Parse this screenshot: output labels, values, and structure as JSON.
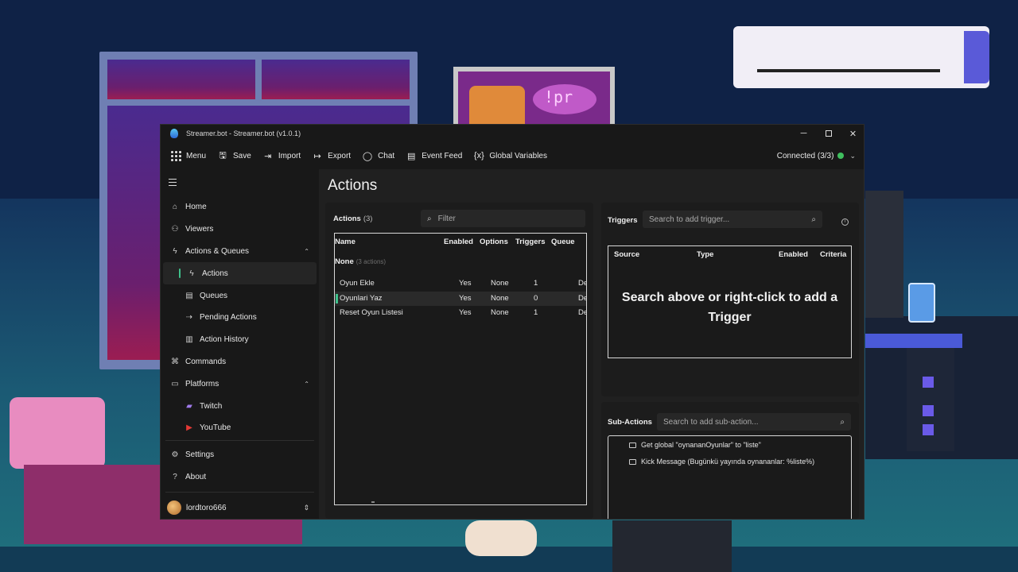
{
  "window": {
    "title": "Streamer.bot - Streamer.bot (v1.0.1)",
    "minimize": "─",
    "close": "✕"
  },
  "toolbar": {
    "menu": "Menu",
    "save": "Save",
    "import": "Import",
    "export": "Export",
    "chat": "Chat",
    "event_feed": "Event Feed",
    "global_variables": "Global Variables",
    "connection": "Connected (3/3)",
    "connection_color": "#3fbf5e"
  },
  "sidebar": {
    "items": [
      {
        "label": "Home",
        "icon": "home-icon"
      },
      {
        "label": "Viewers",
        "icon": "users-icon"
      },
      {
        "label": "Actions & Queues",
        "icon": "bolt-icon"
      },
      {
        "label": "Actions",
        "icon": "bolt-icon"
      },
      {
        "label": "Queues",
        "icon": "queue-icon"
      },
      {
        "label": "Pending Actions",
        "icon": "pending-icon"
      },
      {
        "label": "Action History",
        "icon": "history-icon"
      },
      {
        "label": "Commands",
        "icon": "command-icon"
      },
      {
        "label": "Platforms",
        "icon": "platforms-icon"
      },
      {
        "label": "Twitch",
        "icon": "twitch-icon"
      },
      {
        "label": "YouTube",
        "icon": "youtube-icon"
      }
    ],
    "bottom": [
      {
        "label": "Settings",
        "icon": "gear-icon"
      },
      {
        "label": "About",
        "icon": "help-icon"
      }
    ],
    "user": "lordtoro666"
  },
  "page": {
    "title": "Actions"
  },
  "actions": {
    "header": "Actions",
    "count": "(3)",
    "filter_placeholder": "Filter",
    "columns": [
      "Name",
      "Enabled",
      "Options",
      "Triggers",
      "Queue"
    ],
    "group": {
      "name": "None",
      "count": "(3 actions)"
    },
    "rows": [
      {
        "name": "Oyun Ekle",
        "enabled": "Yes",
        "options": "None",
        "triggers": "1",
        "queue": "De"
      },
      {
        "name": "Oyunlari Yaz",
        "enabled": "Yes",
        "options": "None",
        "triggers": "0",
        "queue": "De"
      },
      {
        "name": "Reset Oyun Listesi",
        "enabled": "Yes",
        "options": "None",
        "triggers": "1",
        "queue": "De"
      }
    ],
    "selected_index": 1,
    "accent": "#3fbf8a"
  },
  "triggers": {
    "header": "Triggers",
    "search_placeholder": "Search to add trigger...",
    "columns": [
      "Source",
      "Type",
      "Enabled",
      "Criteria"
    ],
    "empty_message": "Search above or right-click to add a Trigger"
  },
  "subactions": {
    "header": "Sub-Actions",
    "search_placeholder": "Search to add sub-action...",
    "items": [
      "Get global \"oynananOyunlar\" to \"liste\"",
      "Kick Message (Bugünkü yayında oynananlar: %liste%)"
    ]
  }
}
